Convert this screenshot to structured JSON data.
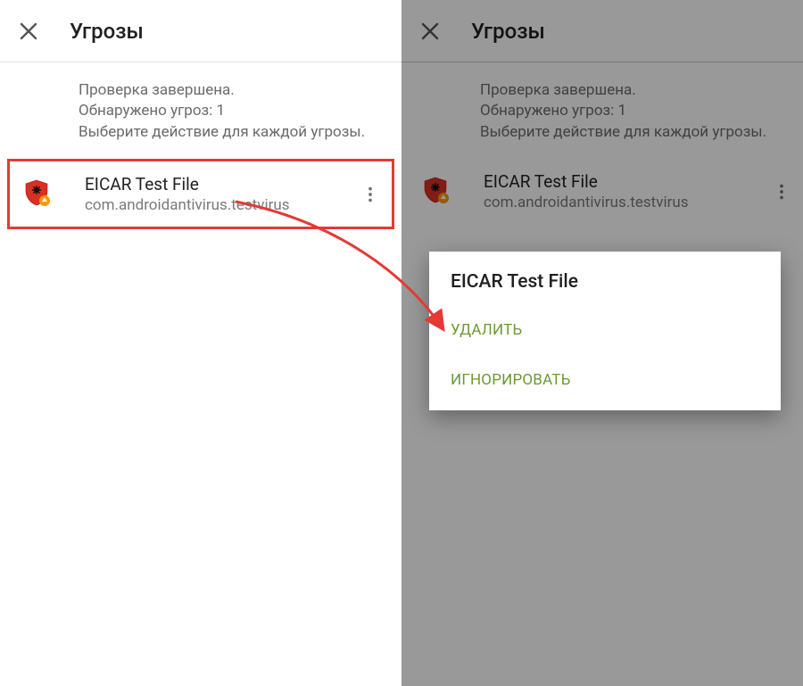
{
  "header": {
    "title": "Угрозы"
  },
  "status": {
    "line1": "Проверка завершена.",
    "line2": "Обнаружено угроз: 1",
    "line3": "Выберите действие для каждой угрозы."
  },
  "threat": {
    "name": "EICAR Test File",
    "package": "com.androidantivirus.testvirus"
  },
  "dialog": {
    "title": "EICAR Test File",
    "delete": "УДАЛИТЬ",
    "ignore": "ИГНОРИРОВАТЬ"
  },
  "colors": {
    "highlight_border": "#e53935",
    "action_text": "#6a9a2f"
  }
}
